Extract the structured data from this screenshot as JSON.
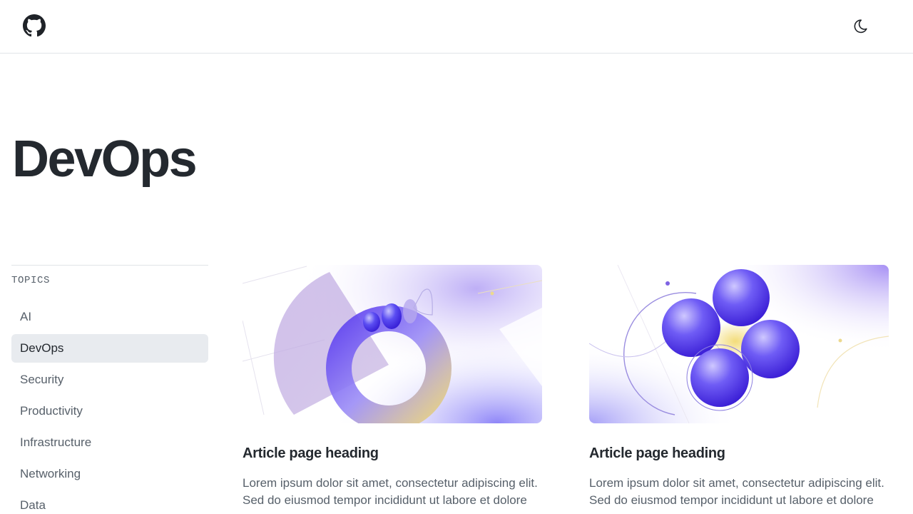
{
  "header": {
    "logo_icon": "github-icon",
    "theme_icon": "moon-icon"
  },
  "page": {
    "title": "DevOps"
  },
  "sidebar": {
    "heading": "TOPICS",
    "items": [
      {
        "label": "AI",
        "active": false
      },
      {
        "label": "DevOps",
        "active": true
      },
      {
        "label": "Security",
        "active": false
      },
      {
        "label": "Productivity",
        "active": false
      },
      {
        "label": "Infrastructure",
        "active": false
      },
      {
        "label": "Networking",
        "active": false
      },
      {
        "label": "Data",
        "active": false
      }
    ]
  },
  "articles": [
    {
      "heading": "Article page heading",
      "excerpt_line1": "Lorem ipsum dolor sit amet, consectetur adipiscing elit.",
      "excerpt_line2": "Sed do eiusmod tempor incididunt ut labore et dolore"
    },
    {
      "heading": "Article page heading",
      "excerpt_line1": "Lorem ipsum dolor sit amet, consectetur adipiscing elit.",
      "excerpt_line2": "Sed do eiusmod tempor incididunt ut labore et dolore"
    }
  ],
  "colors": {
    "accent": "#6e5cf0",
    "active_bg": "#e8ebef",
    "text_primary": "#24292f",
    "text_secondary": "#57606a"
  }
}
